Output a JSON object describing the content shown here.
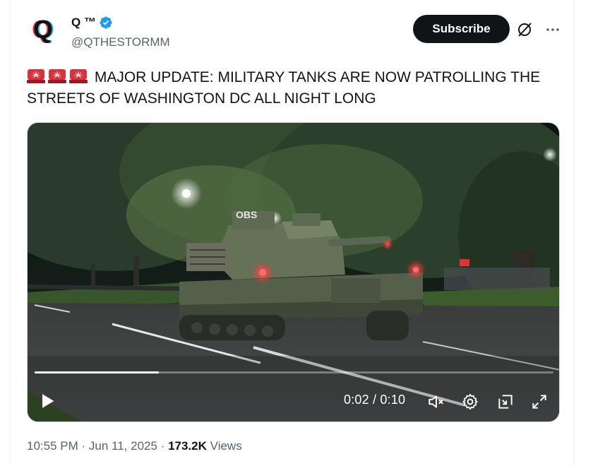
{
  "author": {
    "display_name": "Q ™",
    "handle": "@QTHESTORMM",
    "avatar_letter": "Q",
    "verified": true,
    "verified_color": "#1d9bf0"
  },
  "actions": {
    "subscribe_label": "Subscribe",
    "grok_icon": "grok-slash-icon",
    "more_icon": "more-dots-icon"
  },
  "tweet": {
    "emoji": [
      "🚨",
      "🚨",
      "🚨"
    ],
    "text": "MAJOR UPDATE: MILITARY TANKS ARE NOW PATROLLING THE STREETS OF WASHINGTON DC ALL NIGHT LONG"
  },
  "video": {
    "current_time": "0:02",
    "duration": "0:10",
    "time_display": "0:02 / 0:10",
    "progress_fraction": 0.24,
    "muted": true,
    "tank_marking": "OBS"
  },
  "meta": {
    "time": "10:55 PM",
    "date": "Jun 11, 2025",
    "views_count": "173.2K",
    "views_label": "Views",
    "separator": "·"
  },
  "colors": {
    "text_primary": "#0f1419",
    "text_secondary": "#536471",
    "accent": "#1d9bf0",
    "button_dark": "#0f1419"
  }
}
